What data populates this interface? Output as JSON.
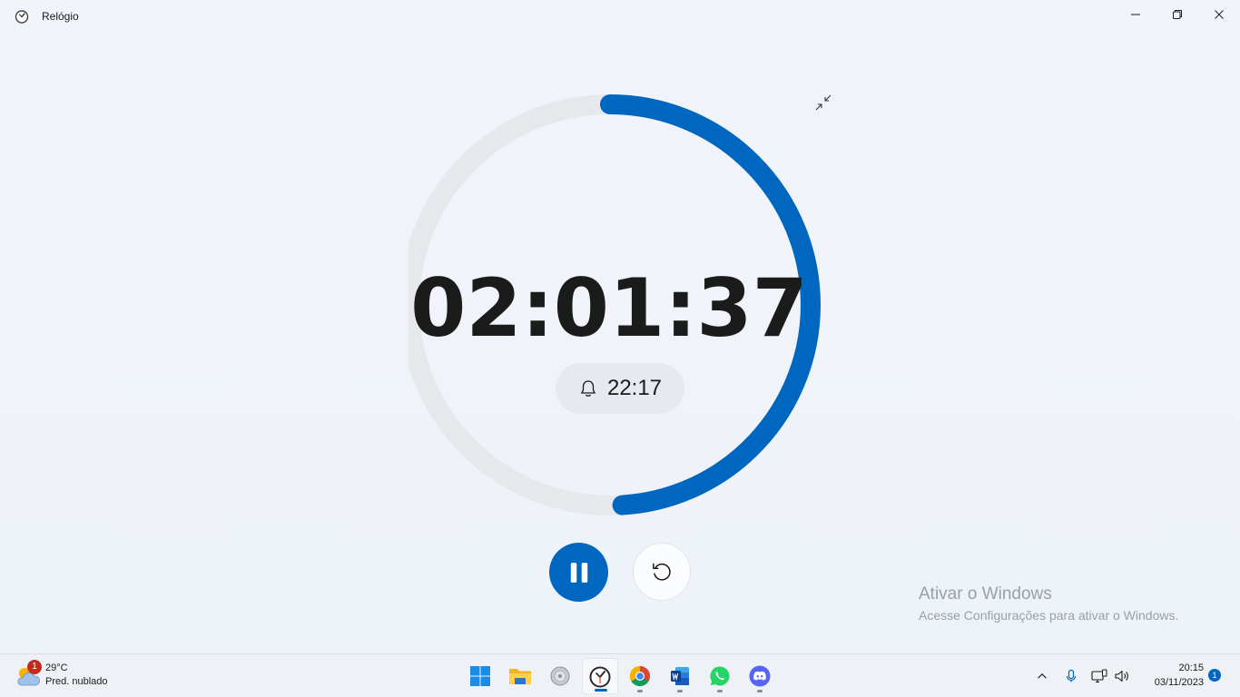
{
  "window": {
    "title": "Relógio",
    "icon": "clock-app-icon",
    "controls": {
      "minimize": "minimize-icon",
      "maximize": "restore-icon",
      "close": "close-icon"
    }
  },
  "timer": {
    "remaining": "02:01:37",
    "alarm_time": "22:17",
    "alarm_icon": "bell-icon",
    "progress_fraction": 0.49,
    "accent_color": "#0067c0",
    "track_color": "#e6e8ec"
  },
  "controls": {
    "pause_icon": "pause-icon",
    "reset_icon": "reset-icon",
    "collapse_icon": "collapse-icon"
  },
  "watermark": {
    "title": "Ativar o Windows",
    "subtitle": "Acesse Configurações para ativar o Windows."
  },
  "taskbar": {
    "weather": {
      "badge": "1",
      "temp": "29°C",
      "desc": "Pred. nublado"
    },
    "apps": [
      {
        "name": "start",
        "icon": "windows-start-icon"
      },
      {
        "name": "file-explorer",
        "icon": "folder-icon"
      },
      {
        "name": "disc-app",
        "icon": "disc-icon"
      },
      {
        "name": "clock",
        "icon": "clock-app-icon"
      },
      {
        "name": "chrome",
        "icon": "chrome-icon"
      },
      {
        "name": "word",
        "icon": "word-icon"
      },
      {
        "name": "whatsapp",
        "icon": "whatsapp-icon"
      },
      {
        "name": "discord",
        "icon": "discord-icon"
      }
    ],
    "tray": {
      "time": "20:15",
      "date": "03/11/2023",
      "notifications": "1"
    }
  }
}
